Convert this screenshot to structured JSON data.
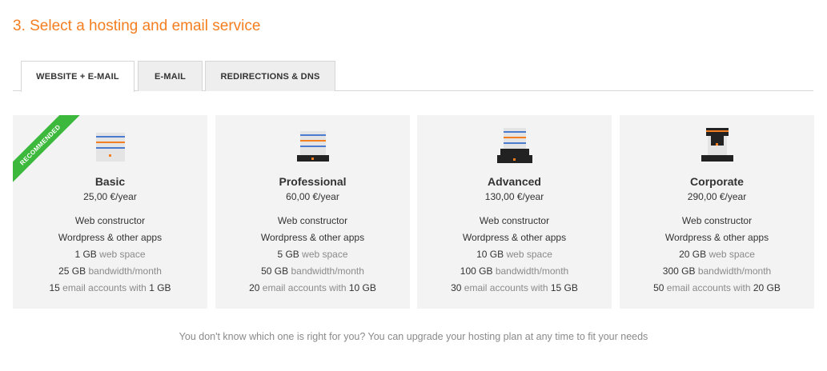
{
  "section": {
    "title": "3. Select a hosting and email service"
  },
  "tabs": [
    {
      "label": "WEBSITE + E-MAIL",
      "active": true
    },
    {
      "label": "E-MAIL",
      "active": false
    },
    {
      "label": "REDIRECTIONS & DNS",
      "active": false
    }
  ],
  "ribbon": {
    "label": "RECOMMENDED"
  },
  "plans": [
    {
      "name": "Basic",
      "price": "25,00 €/year",
      "constructor": "Web constructor",
      "apps": "Wordpress & other apps",
      "space_value": "1 GB",
      "space_label": "web space",
      "bandwidth_value": "25 GB",
      "bandwidth_label": "bandwidth/month",
      "accounts_count": "15",
      "accounts_label": "email accounts with",
      "accounts_size": "1 GB"
    },
    {
      "name": "Professional",
      "price": "60,00 €/year",
      "constructor": "Web constructor",
      "apps": "Wordpress & other apps",
      "space_value": "5 GB",
      "space_label": "web space",
      "bandwidth_value": "50 GB",
      "bandwidth_label": "bandwidth/month",
      "accounts_count": "20",
      "accounts_label": "email accounts with",
      "accounts_size": "10 GB"
    },
    {
      "name": "Advanced",
      "price": "130,00 €/year",
      "constructor": "Web constructor",
      "apps": "Wordpress & other apps",
      "space_value": "10 GB",
      "space_label": "web space",
      "bandwidth_value": "100 GB",
      "bandwidth_label": "bandwidth/month",
      "accounts_count": "30",
      "accounts_label": "email accounts with",
      "accounts_size": "15 GB"
    },
    {
      "name": "Corporate",
      "price": "290,00 €/year",
      "constructor": "Web constructor",
      "apps": "Wordpress & other apps",
      "space_value": "20 GB",
      "space_label": "web space",
      "bandwidth_value": "300 GB",
      "bandwidth_label": "bandwidth/month",
      "accounts_count": "50",
      "accounts_label": "email accounts with",
      "accounts_size": "20 GB"
    }
  ],
  "footer": {
    "note": "You don't know which one is right for you? You can upgrade your hosting plan at any time to fit your needs"
  },
  "colors": {
    "accent": "#f47e20",
    "ribbon": "#3cb93c",
    "server_stripe": "#4a7bd0",
    "card_bg": "#f3f3f3"
  },
  "icons": [
    "server-basic-icon",
    "server-professional-icon",
    "server-advanced-icon",
    "server-corporate-icon"
  ]
}
